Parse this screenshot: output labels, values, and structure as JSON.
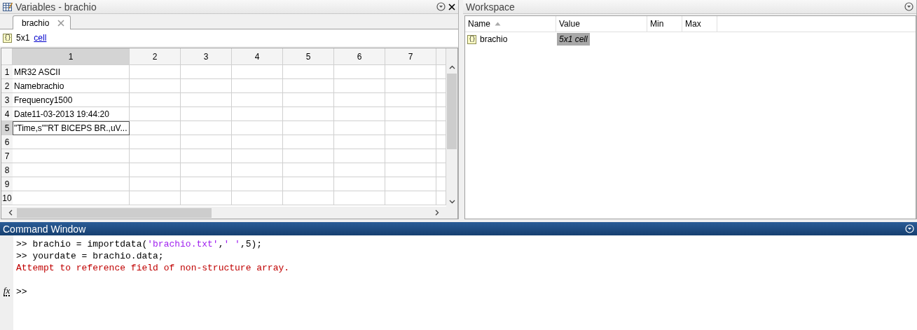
{
  "variables": {
    "title": "Variables - brachio",
    "tabs": [
      {
        "label": "brachio",
        "selected": true
      }
    ],
    "summary": {
      "icon": "{}",
      "size": "5x1",
      "class_link": "cell"
    },
    "table": {
      "columns": [
        "1",
        "2",
        "3",
        "4",
        "5",
        "6",
        "7"
      ],
      "rows": [
        {
          "label": "1",
          "cells": [
            "MR32 ASCII"
          ],
          "selected": false
        },
        {
          "label": "2",
          "cells": [
            "Namebrachio"
          ],
          "selected": false
        },
        {
          "label": "3",
          "cells": [
            "Frequency1500"
          ],
          "selected": false
        },
        {
          "label": "4",
          "cells": [
            "Date11-03-2013 19:44:20"
          ],
          "selected": false
        },
        {
          "label": "5",
          "cells": [
            "\"Time,s\"\"RT BICEPS BR.,uV..."
          ],
          "selected": true
        },
        {
          "label": "6",
          "cells": [],
          "selected": false
        },
        {
          "label": "7",
          "cells": [],
          "selected": false
        },
        {
          "label": "8",
          "cells": [],
          "selected": false
        },
        {
          "label": "9",
          "cells": [],
          "selected": false
        },
        {
          "label": "10",
          "cells": [],
          "selected": false
        }
      ]
    }
  },
  "workspace": {
    "title": "Workspace",
    "columns": [
      {
        "label": "Name",
        "sorted": true
      },
      {
        "label": "Value",
        "sorted": false
      },
      {
        "label": "Min",
        "sorted": false
      },
      {
        "label": "Max",
        "sorted": false
      }
    ],
    "rows": [
      {
        "icon": "{}",
        "name": "brachio",
        "value": "5x1 cell",
        "selected": true
      }
    ]
  },
  "command_window": {
    "title": "Command Window",
    "function_button": "fx",
    "lines": [
      {
        "kind": "command",
        "prompt": ">>",
        "parts": [
          {
            "kind": "code",
            "text": "brachio = importdata("
          },
          {
            "kind": "string",
            "text": "'brachio.txt'"
          },
          {
            "kind": "code",
            "text": ","
          },
          {
            "kind": "string",
            "text": "' '"
          },
          {
            "kind": "code",
            "text": ",5);"
          }
        ]
      },
      {
        "kind": "command",
        "prompt": ">>",
        "parts": [
          {
            "kind": "code",
            "text": "yourdate = brachio.data;"
          }
        ]
      },
      {
        "kind": "error",
        "text": "Attempt to reference field of non-structure array."
      },
      {
        "kind": "prompt",
        "prompt": ">>"
      }
    ]
  }
}
